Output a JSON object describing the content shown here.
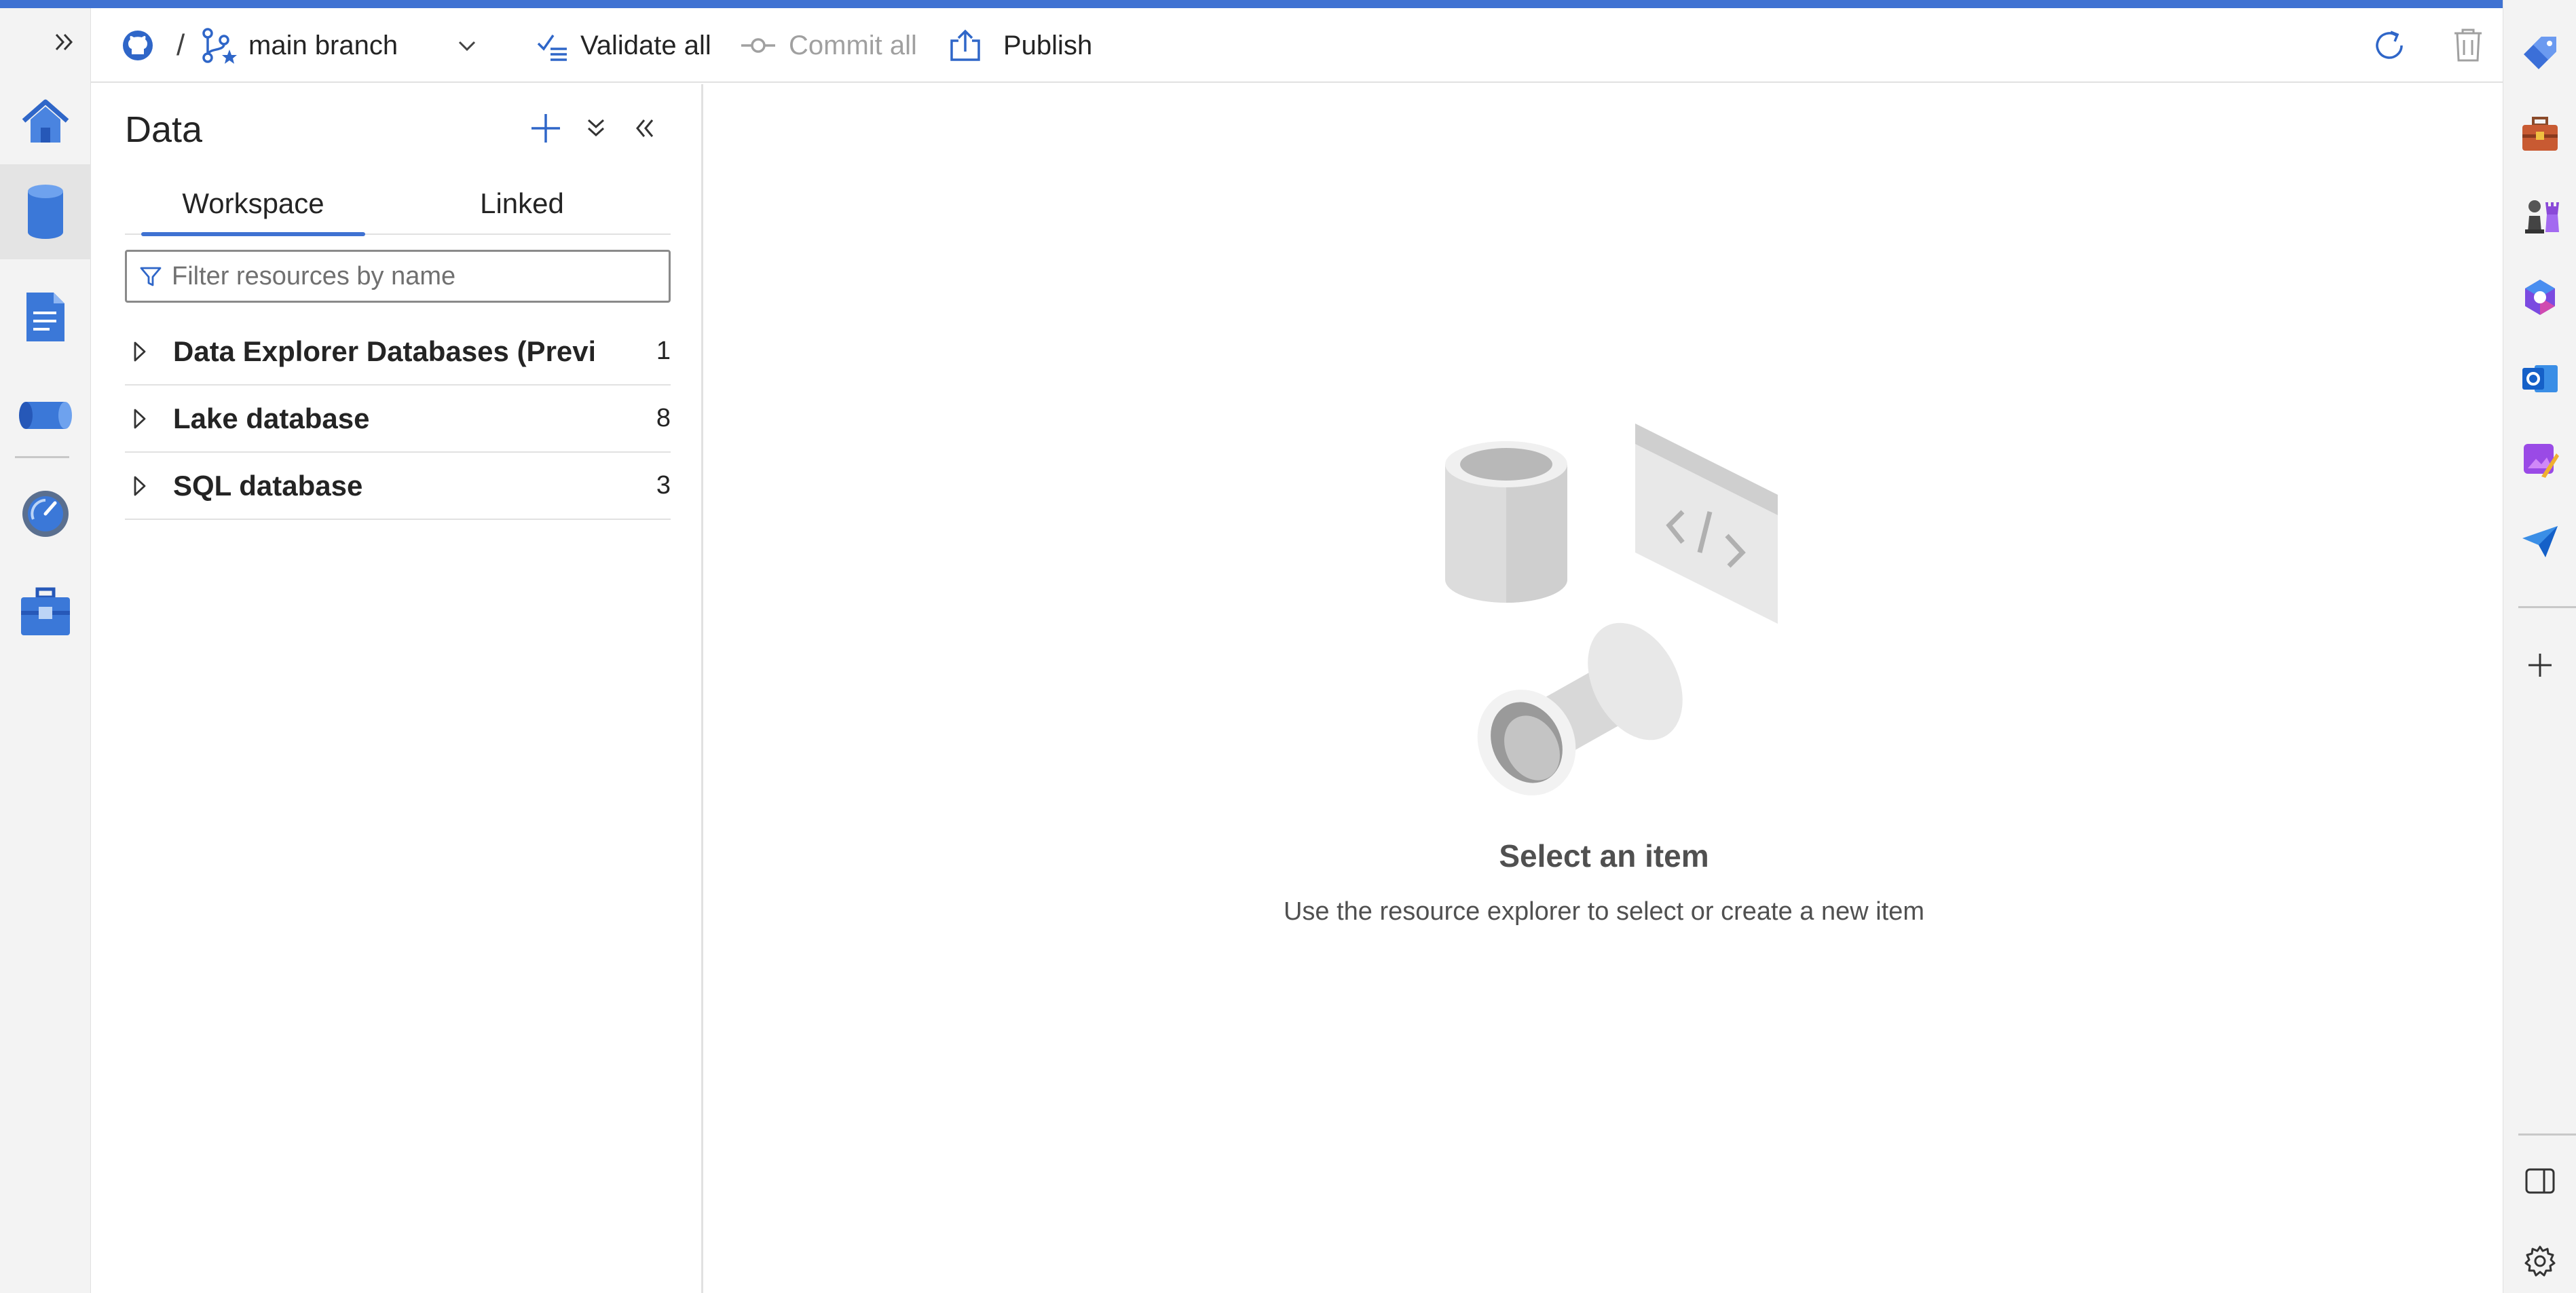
{
  "toolbar": {
    "branch": "main branch",
    "separator": "/",
    "validate_all": "Validate all",
    "commit_all": "Commit all",
    "publish": "Publish"
  },
  "left_rail": {
    "icons": [
      "expand-icon",
      "home-icon",
      "data-icon",
      "develop-icon",
      "integrate-icon",
      "monitor-icon",
      "manage-icon"
    ],
    "active": "data-icon"
  },
  "data_pane": {
    "title": "Data",
    "tabs": [
      {
        "label": "Workspace",
        "active": true
      },
      {
        "label": "Linked",
        "active": false
      }
    ],
    "filter_placeholder": "Filter resources by name",
    "items": [
      {
        "name": "Data Explorer Databases (Previ...",
        "count": "1"
      },
      {
        "name": "Lake database",
        "count": "8"
      },
      {
        "name": "SQL database",
        "count": "3"
      }
    ]
  },
  "main": {
    "empty_title": "Select an item",
    "empty_subtitle": "Use the resource explorer to select or create a new item"
  },
  "right_rail": {
    "icons": [
      "tag-icon",
      "toolbox-icon",
      "chess-icon",
      "copilot-icon",
      "outlook-icon",
      "designer-icon",
      "send-icon",
      "add-icon",
      "panel-icon",
      "settings-icon"
    ]
  },
  "colors": {
    "accent": "#3f72d2",
    "rail_bg": "#f3f3f3",
    "text": "#242424",
    "muted": "#505050"
  }
}
